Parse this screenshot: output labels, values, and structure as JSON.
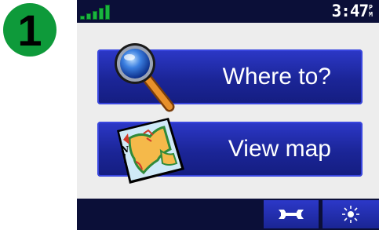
{
  "step": {
    "number": "1"
  },
  "status_bar": {
    "signal_bars_lit": 4,
    "time": "3:47",
    "ampm_top": "P",
    "ampm_bottom": "M"
  },
  "menu": {
    "where_to": {
      "label": "Where to?",
      "icon": "magnifying-glass-icon"
    },
    "view_map": {
      "label": "View map",
      "icon": "map-icon"
    }
  },
  "toolbar": {
    "tools": {
      "icon": "wrench-icon"
    },
    "brightness": {
      "icon": "brightness-icon"
    }
  },
  "colors": {
    "badge": "#0e9a3a",
    "button": "#1b2597",
    "bar": "#0b0f38",
    "screen": "#ededed",
    "signal": "#19b53f"
  }
}
